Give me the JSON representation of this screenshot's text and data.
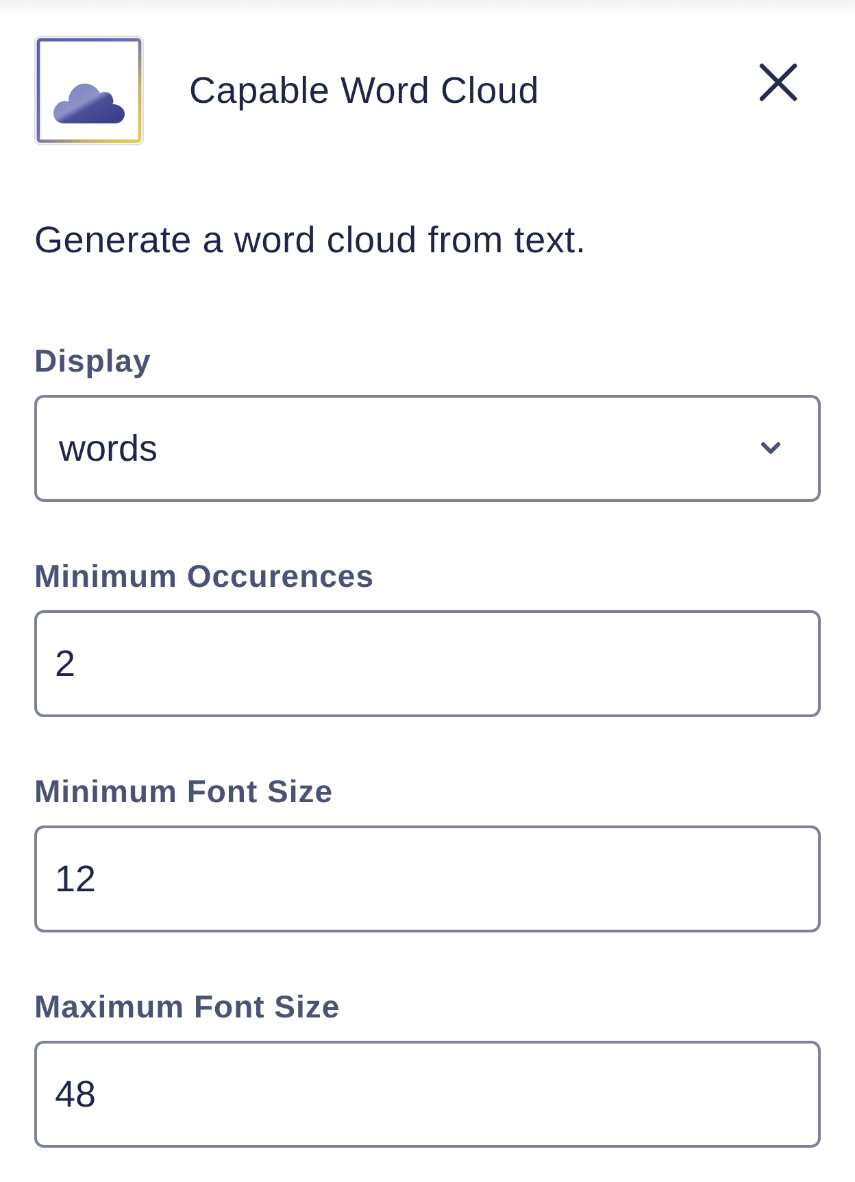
{
  "header": {
    "title": "Capable Word Cloud"
  },
  "description": "Generate a word cloud from text.",
  "fields": [
    {
      "kind": "select",
      "label": "Display",
      "value": "words"
    },
    {
      "kind": "input",
      "label": "Minimum Occurences",
      "value": "2"
    },
    {
      "kind": "input",
      "label": "Minimum Font Size",
      "value": "12"
    },
    {
      "kind": "input",
      "label": "Maximum Font Size",
      "value": "48"
    }
  ]
}
